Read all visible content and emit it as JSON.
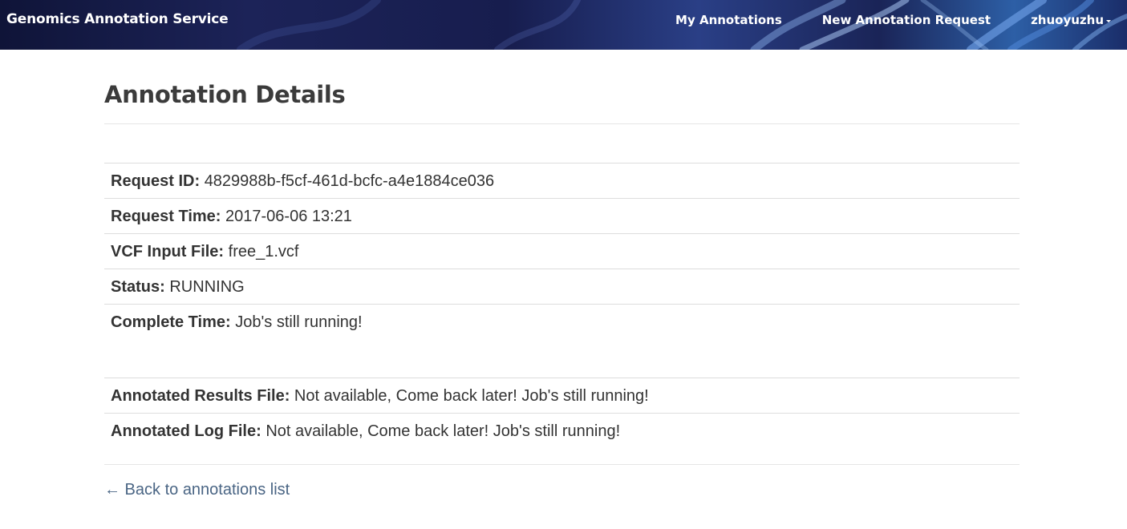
{
  "navbar": {
    "brand": "Genomics Annotation Service",
    "links": [
      {
        "label": "My Annotations"
      },
      {
        "label": "New Annotation Request"
      }
    ],
    "user": "zhuoyuzhu"
  },
  "page": {
    "title": "Annotation Details"
  },
  "details": {
    "request_id": {
      "label": "Request ID:",
      "value": "4829988b-f5cf-461d-bcfc-a4e1884ce036"
    },
    "request_time": {
      "label": "Request Time:",
      "value": "2017-06-06 13:21"
    },
    "input_file": {
      "label": "VCF Input File:",
      "value": "free_1.vcf"
    },
    "status": {
      "label": "Status:",
      "value": "RUNNING"
    },
    "complete_time": {
      "label": "Complete Time:",
      "value": "Job's still running!"
    }
  },
  "files": {
    "results": {
      "label": "Annotated Results File:",
      "value": "Not available, Come back later! Job's still running!"
    },
    "log": {
      "label": "Annotated Log File:",
      "value": "Not available, Come back later! Job's still running!"
    }
  },
  "back_link": "← Back to annotations list",
  "colors": {
    "link": "#4a6584",
    "text": "#333333",
    "navbar": "#1c2358"
  }
}
